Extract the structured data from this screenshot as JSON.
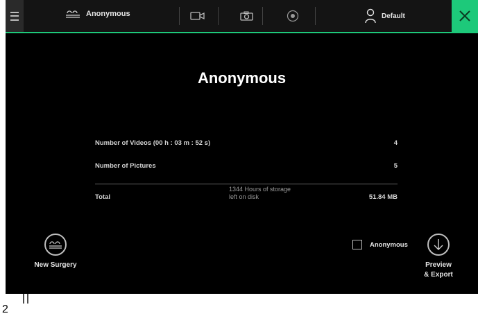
{
  "topbar": {
    "menu_icon": "hamburger-menu-icon",
    "patient_icon": "patient-id-icon",
    "patient_name": "Anonymous",
    "tool_icons": [
      "video-camera-icon",
      "photo-camera-icon",
      "record-icon"
    ],
    "user_icon": "user-icon",
    "user_name": "Default",
    "close_icon": "close-icon",
    "accent_color": "#1dc97a"
  },
  "main": {
    "title": "Anonymous",
    "rows": [
      {
        "label": "Number of Videos  (00 h : 03 m : 52 s)",
        "value": "4"
      },
      {
        "label": "Number of Pictures",
        "value": "5"
      }
    ],
    "total": {
      "label": "Total",
      "storage_note_line1": "1344 Hours of storage",
      "storage_note_line2": "left on disk",
      "value": "51.84 MB"
    }
  },
  "footer": {
    "new_surgery_label": "New Surgery",
    "new_surgery_icon": "patient-id-icon",
    "anonymous_checkbox_label": "Anonymous",
    "anonymous_checked": false,
    "export_label_line1": "Preview",
    "export_label_line2": "& Export",
    "export_icon": "download-arrow-icon"
  },
  "callout": {
    "number": "2"
  }
}
